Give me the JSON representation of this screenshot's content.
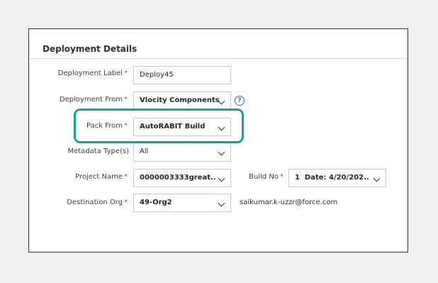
{
  "section": {
    "title": "Deployment Details"
  },
  "fields": {
    "deployment_label": {
      "label": "Deployment Label",
      "required": "*",
      "value": "Deploy45"
    },
    "deployment_from": {
      "label": "Deployment From",
      "required": "*",
      "value": "Vlocity Components",
      "help_icon": "?"
    },
    "pack_from": {
      "label": "Pack From",
      "required": "*",
      "value": "AutoRABIT Build"
    },
    "metadata_types": {
      "label": "Metadata Type(s)",
      "value": "All"
    },
    "project_name": {
      "label": "Project Name",
      "required": "*",
      "value": "0000003333great.."
    },
    "build_no": {
      "label": "Build No",
      "required": "*",
      "value": "1  Date: 4/20/202.."
    },
    "destination_org": {
      "label": "Destination Org",
      "required": "*",
      "value": "49-Org2",
      "username": "saikumar.k-uzzr@force.com"
    }
  },
  "colors": {
    "highlight": "#1aa38c",
    "required": "#e0312b",
    "help": "#2368d6"
  }
}
